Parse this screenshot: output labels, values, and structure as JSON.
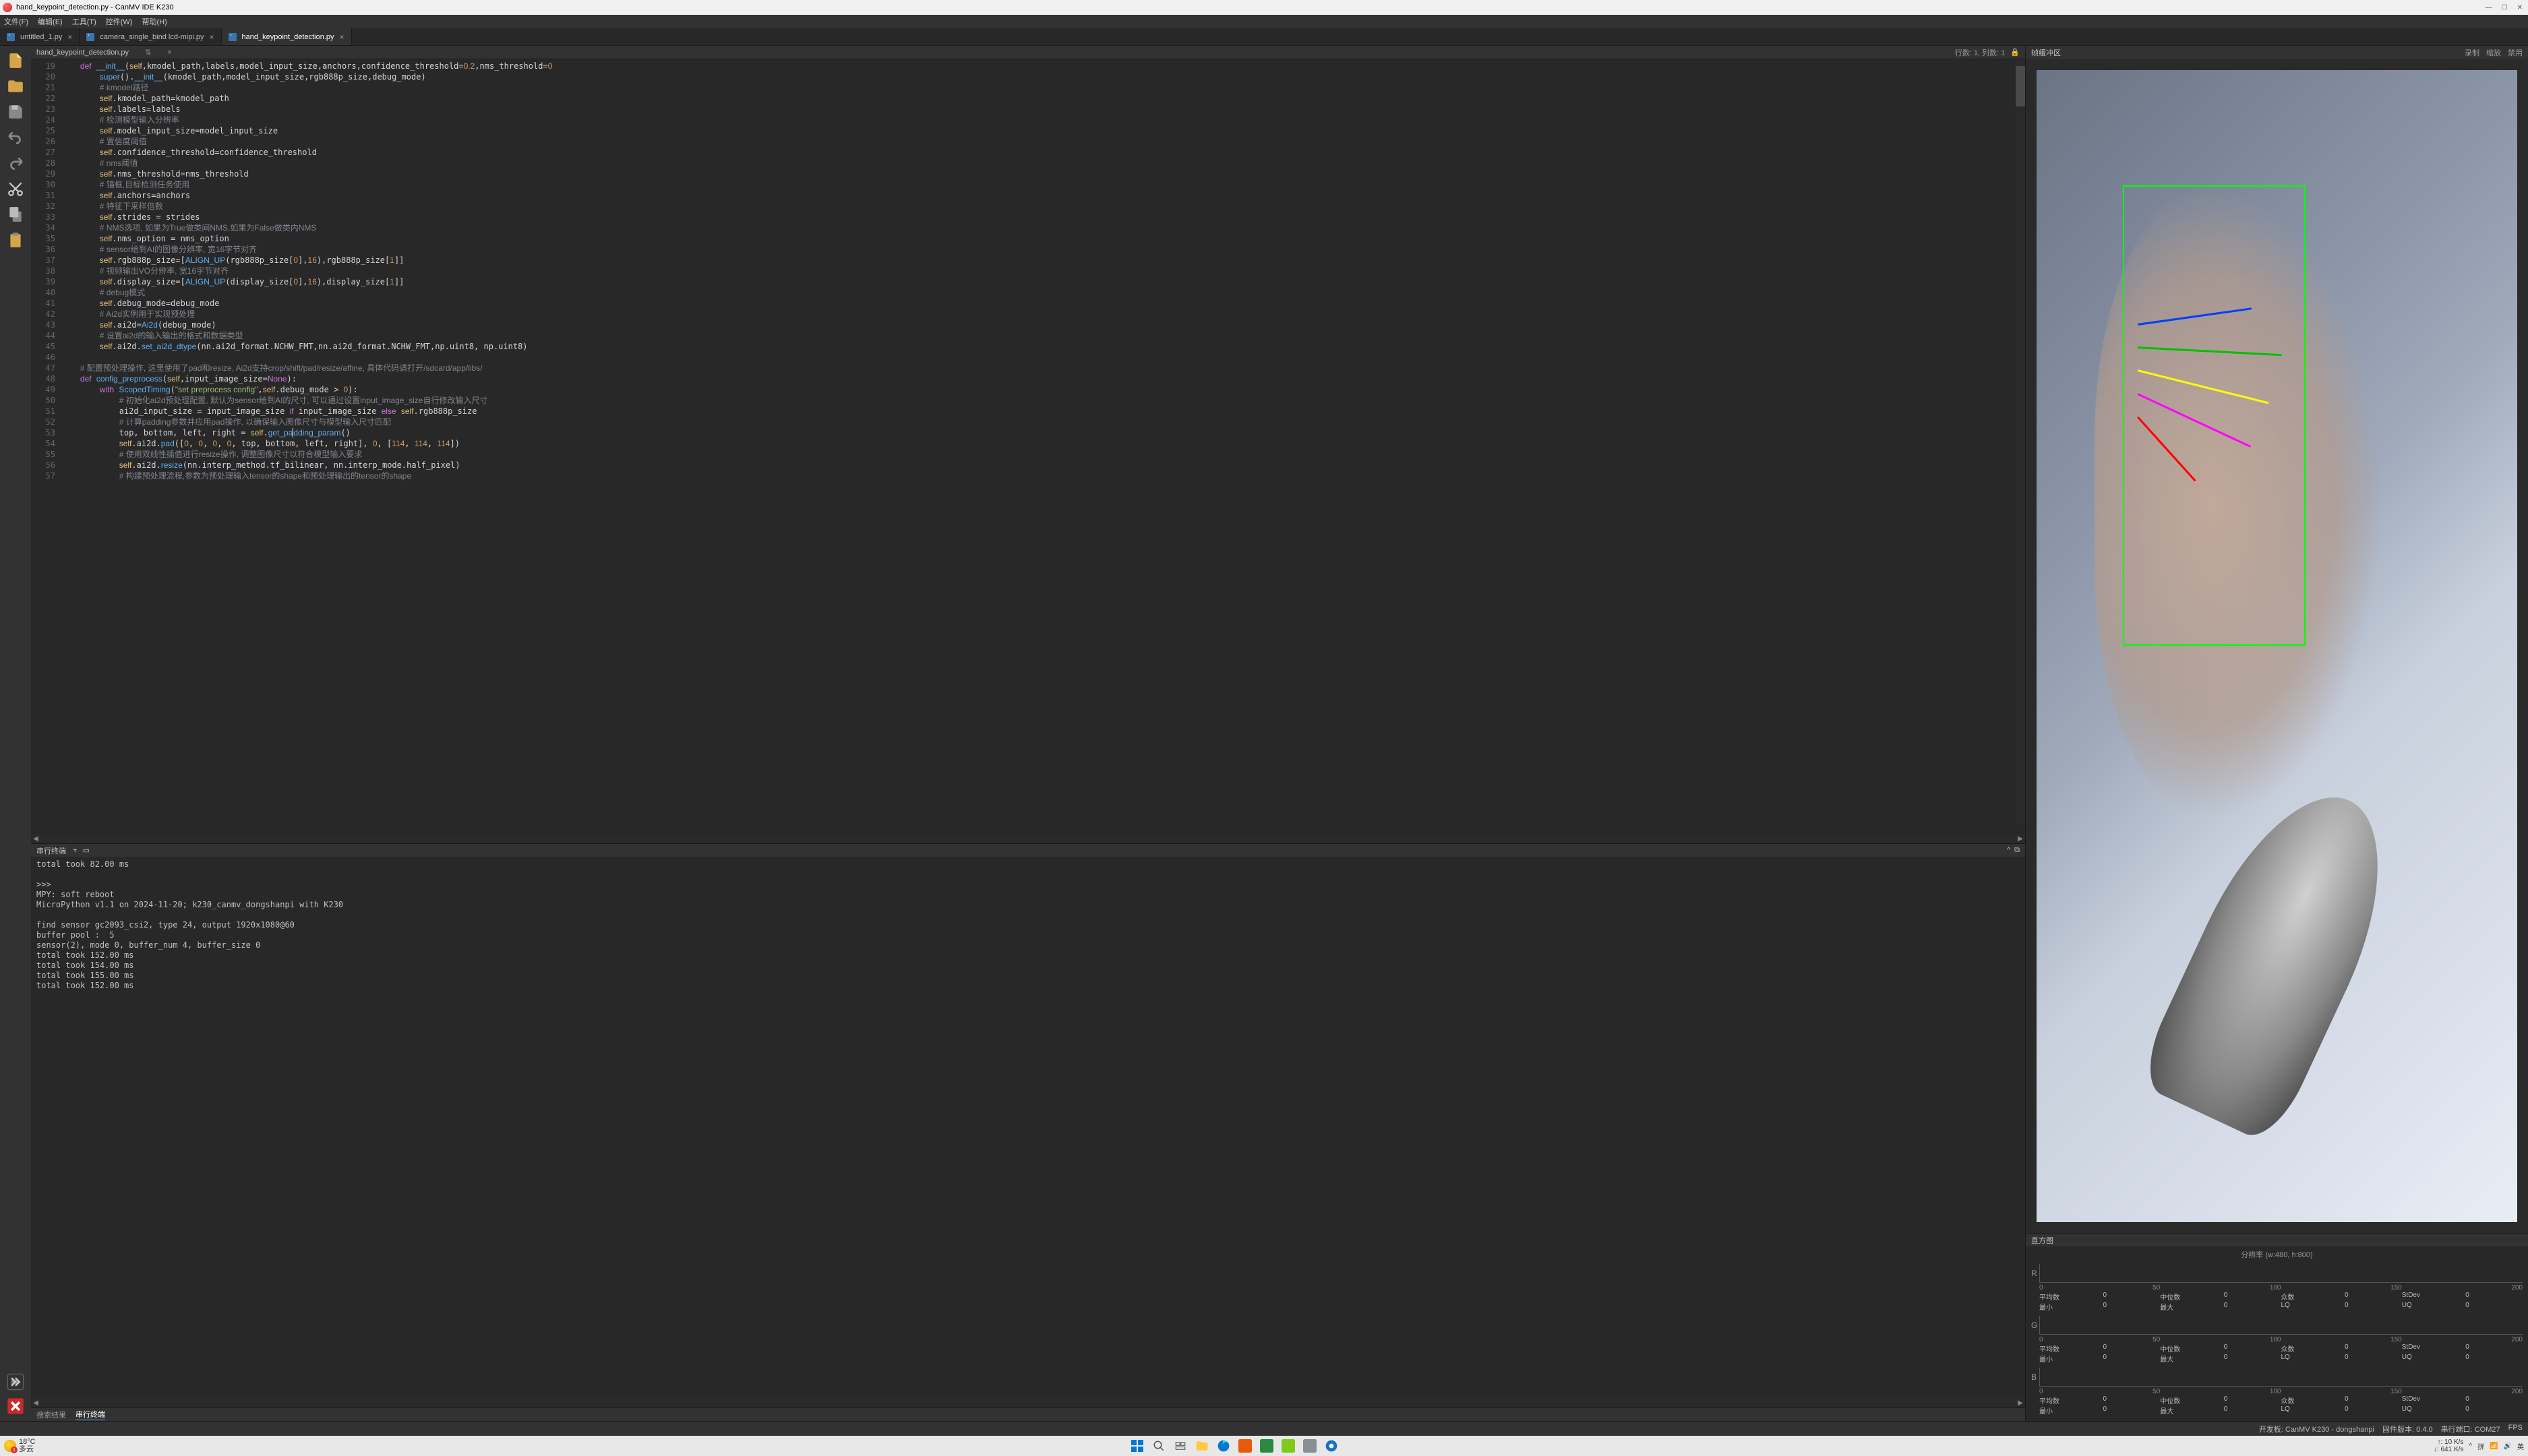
{
  "window": {
    "title": "hand_keypoint_detection.py - CanMV IDE K230"
  },
  "menu": {
    "file": "文件(F)",
    "edit": "编辑(E)",
    "tools": "工具(T)",
    "widget": "控件(W)",
    "help": "帮助(H)"
  },
  "tabs": [
    {
      "label": "untitled_1.py"
    },
    {
      "label": "camera_single_bind lcd-mipi.py"
    },
    {
      "label": "hand_keypoint_detection.py"
    }
  ],
  "editor": {
    "filename": "hand_keypoint_detection.py",
    "position": "行数: 1, 列数: 1"
  },
  "framebuffer": {
    "title": "帧缓冲区",
    "rec": "录制",
    "zoom": "缩放",
    "disable": "禁用"
  },
  "histogram": {
    "title": "直方图",
    "resolution": "分辨率 (w:480, h:800)"
  },
  "hist_ticks": [
    "0",
    "50",
    "100",
    "150",
    "200"
  ],
  "hist_channels": [
    "R",
    "G",
    "B"
  ],
  "hist_stats": {
    "mean_label": "平均数",
    "median_label": "中位数",
    "mode_label": "众数",
    "stdev_label": "StDev",
    "min_label": "最小",
    "max_label": "最大",
    "lq_label": "LQ",
    "uq_label": "UQ",
    "mean": "0",
    "median": "0",
    "mode": "0",
    "stdev": "0",
    "min": "0",
    "max": "0",
    "lq": "0",
    "uq": "0"
  },
  "terminal": {
    "title": "串行终端",
    "content": "total took 82.00 ms\n\n>>> \nMPY: soft reboot\nMicroPython v1.1 on 2024-11-20; k230_canmv_dongshanpi with K230\n\nfind sensor gc2093_csi2, type 24, output 1920x1080@60\nbuffer pool :  5\nsensor(2), mode 0, buffer_num 4, buffer_size 0\ntotal took 152.00 ms\ntotal took 154.00 ms\ntotal took 155.00 ms\ntotal took 152.00 ms"
  },
  "term_tabs": {
    "search": "搜索结果",
    "serial": "串行终端"
  },
  "status": {
    "board": "开发板:",
    "board_val": "CanMV K230 - dongshanpi",
    "fw": "固件版本:",
    "fw_val": "0.4.0",
    "port": "串行端口:",
    "port_val": "COM27",
    "fps": "FPS"
  },
  "weather": {
    "temp": "18°C",
    "desc": "多云"
  },
  "tray": {
    "up": "↑: 10 K/s",
    "down": "↓: 641 K/s",
    "arrow": "^",
    "lang1": "拼",
    "lang2": "英",
    "wifi": "📶",
    "sound": "🔊"
  },
  "code_lines": [
    19,
    20,
    21,
    22,
    23,
    24,
    25,
    26,
    27,
    28,
    29,
    30,
    31,
    32,
    33,
    34,
    35,
    36,
    37,
    38,
    39,
    40,
    41,
    42,
    43,
    44,
    45,
    46,
    47,
    48,
    49,
    50,
    51,
    52,
    53,
    54,
    55,
    56,
    57
  ],
  "chart_data": {
    "type": "bar",
    "title": "RGB Histogram",
    "xlim": [
      0,
      255
    ],
    "ticks": [
      0,
      50,
      100,
      150,
      200
    ],
    "series": [
      {
        "name": "R",
        "stats": {
          "mean": 0,
          "median": 0,
          "mode": 0,
          "stdev": 0,
          "min": 0,
          "max": 0,
          "lq": 0,
          "uq": 0
        }
      },
      {
        "name": "G",
        "stats": {
          "mean": 0,
          "median": 0,
          "mode": 0,
          "stdev": 0,
          "min": 0,
          "max": 0,
          "lq": 0,
          "uq": 0
        }
      },
      {
        "name": "B",
        "stats": {
          "mean": 0,
          "median": 0,
          "mode": 0,
          "stdev": 0,
          "min": 0,
          "max": 0,
          "lq": 0,
          "uq": 0
        }
      }
    ]
  }
}
